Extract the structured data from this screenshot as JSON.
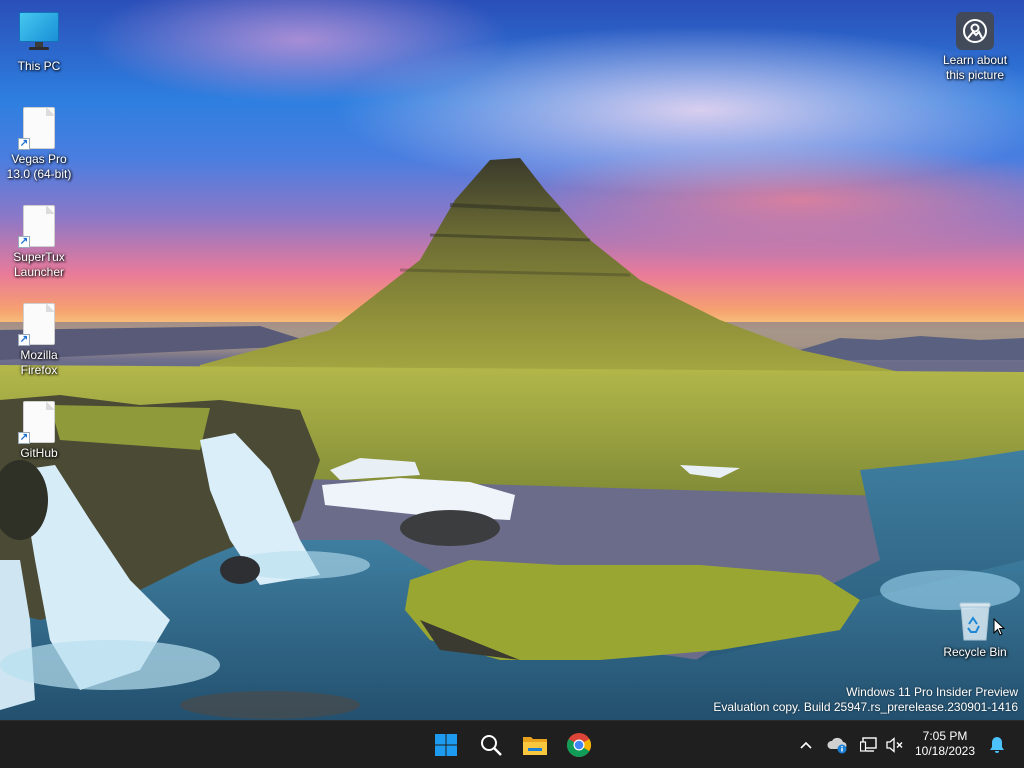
{
  "desktop": {
    "icons": [
      {
        "label": "This PC"
      },
      {
        "label": "Vegas Pro 13.0 (64-bit)"
      },
      {
        "label": "SuperTux Launcher"
      },
      {
        "label": "Mozilla Firefox"
      },
      {
        "label": "GitHub"
      }
    ],
    "learn_about_picture": "Learn about this picture",
    "recycle_bin": "Recycle Bin"
  },
  "watermark": {
    "line1": "Windows 11 Pro Insider Preview",
    "line2": "Evaluation copy. Build 25947.rs_prerelease.230901-1416"
  },
  "taskbar": {
    "apps": [
      {
        "icon": "windows-start-icon"
      },
      {
        "icon": "search-icon"
      },
      {
        "icon": "file-explorer-icon"
      },
      {
        "icon": "chrome-icon"
      }
    ],
    "tray": {
      "time": "7:05 PM",
      "date": "10/18/2023"
    }
  },
  "colors": {
    "taskbar_bg": "#1f1f1f",
    "accent_blue": "#1c9bf0",
    "notification_blue": "#4cc2ff"
  }
}
